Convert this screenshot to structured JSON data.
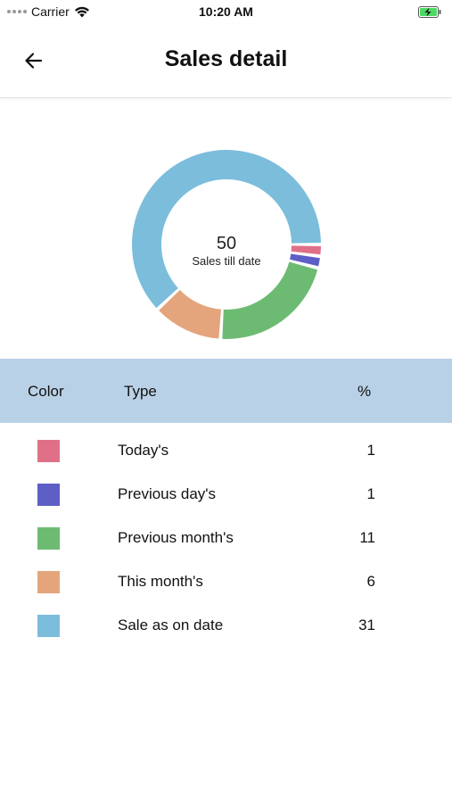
{
  "status_bar": {
    "carrier": "Carrier",
    "time": "10:20 AM"
  },
  "header": {
    "title": "Sales detail"
  },
  "colors": {
    "today": "#e07088",
    "previous_day": "#5e5fc6",
    "previous_month": "#6dbb72",
    "this_month": "#e4a57c",
    "sale_as_on_date": "#7cbddb",
    "table_header_bg": "#b9d1e6"
  },
  "chart": {
    "total": "50",
    "center_label": "Sales till date"
  },
  "chart_data": {
    "type": "pie",
    "categories": [
      "Today's",
      "Previous day's",
      "Previous month's",
      "This month's",
      "Sale as on date"
    ],
    "values": [
      1,
      1,
      11,
      6,
      31
    ],
    "colors": [
      "#e07088",
      "#5e5fc6",
      "#6dbb72",
      "#e4a57c",
      "#7cbddb"
    ],
    "title": "",
    "legend": "table-below"
  },
  "table": {
    "headers": {
      "color": "Color",
      "type": "Type",
      "percent": "%"
    },
    "rows": [
      {
        "type": "Today's",
        "value": "1",
        "color": "#e07088"
      },
      {
        "type": "Previous day's",
        "value": "1",
        "color": "#5e5fc6"
      },
      {
        "type": "Previous month's",
        "value": "11",
        "color": "#6dbb72"
      },
      {
        "type": "This month's",
        "value": "6",
        "color": "#e4a57c"
      },
      {
        "type": "Sale as on date",
        "value": "31",
        "color": "#7cbddb"
      }
    ]
  }
}
